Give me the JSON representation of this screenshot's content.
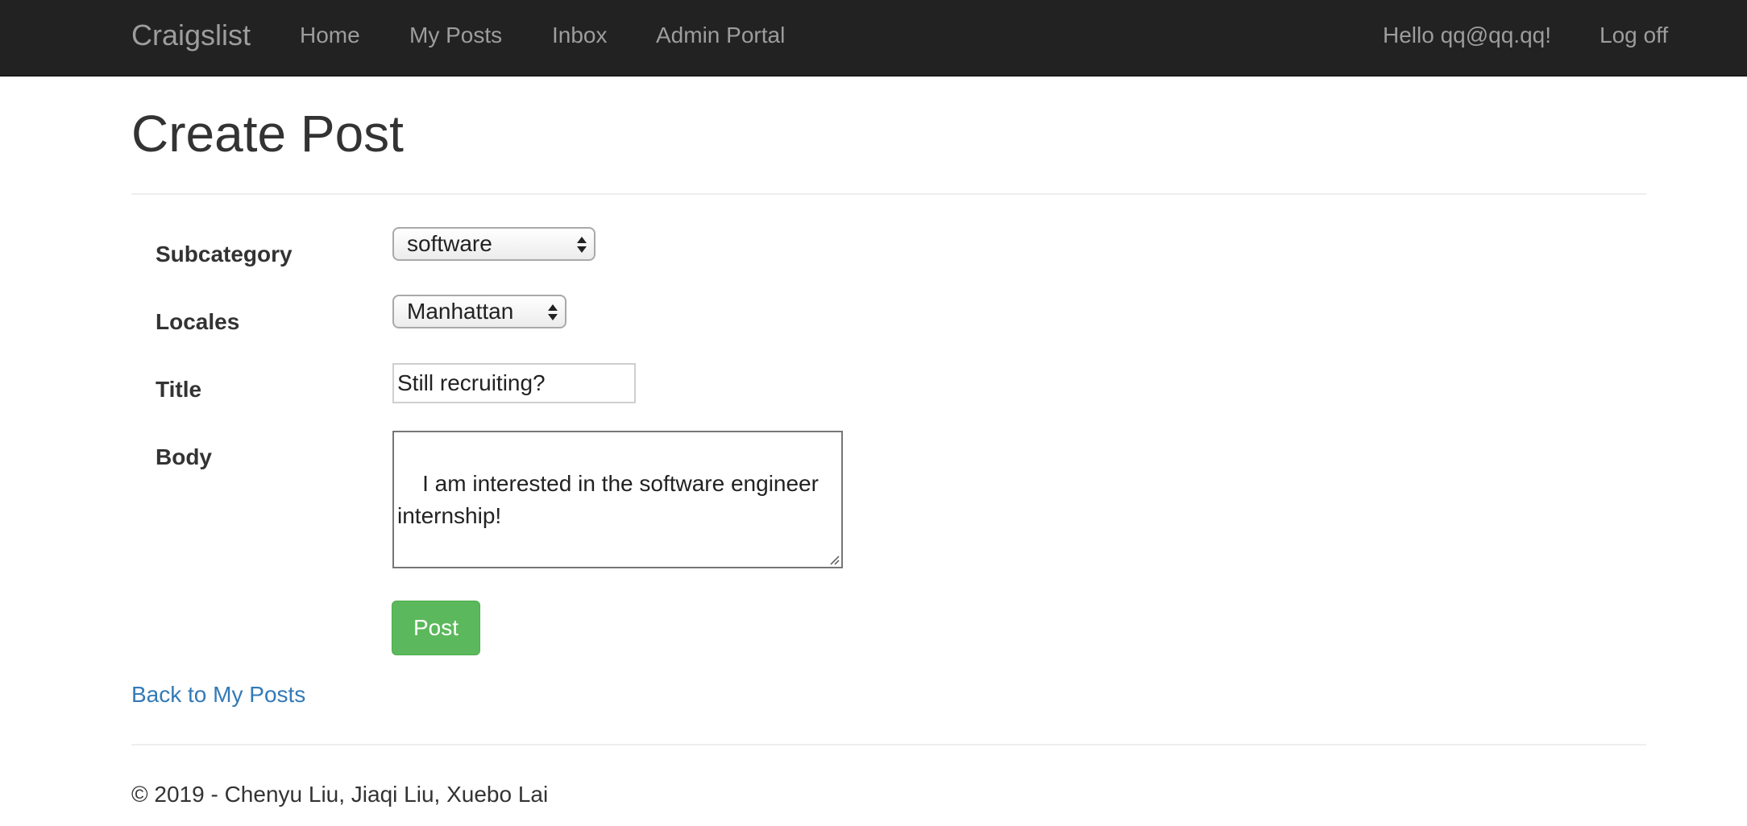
{
  "navbar": {
    "brand": "Craigslist",
    "links": {
      "home": "Home",
      "my_posts": "My Posts",
      "inbox": "Inbox",
      "admin_portal": "Admin Portal"
    },
    "greeting": "Hello qq@qq.qq!",
    "logoff": "Log off",
    "background": "#222222",
    "link_color": "#9d9d9d"
  },
  "page": {
    "title": "Create Post"
  },
  "form": {
    "subcategory": {
      "label": "Subcategory",
      "value": "software"
    },
    "locales": {
      "label": "Locales",
      "value": "Manhattan"
    },
    "title": {
      "label": "Title",
      "value": "Still recruiting?"
    },
    "body": {
      "label": "Body",
      "value": "I am interested in the software engineer internship!"
    },
    "submit_label": "Post",
    "submit_color": "#5cb85c"
  },
  "back_link": "Back to My Posts",
  "link_color": "#337ab7",
  "footer": {
    "copyright": "© 2019 - Chenyu Liu, Jiaqi Liu, Xuebo Lai"
  }
}
